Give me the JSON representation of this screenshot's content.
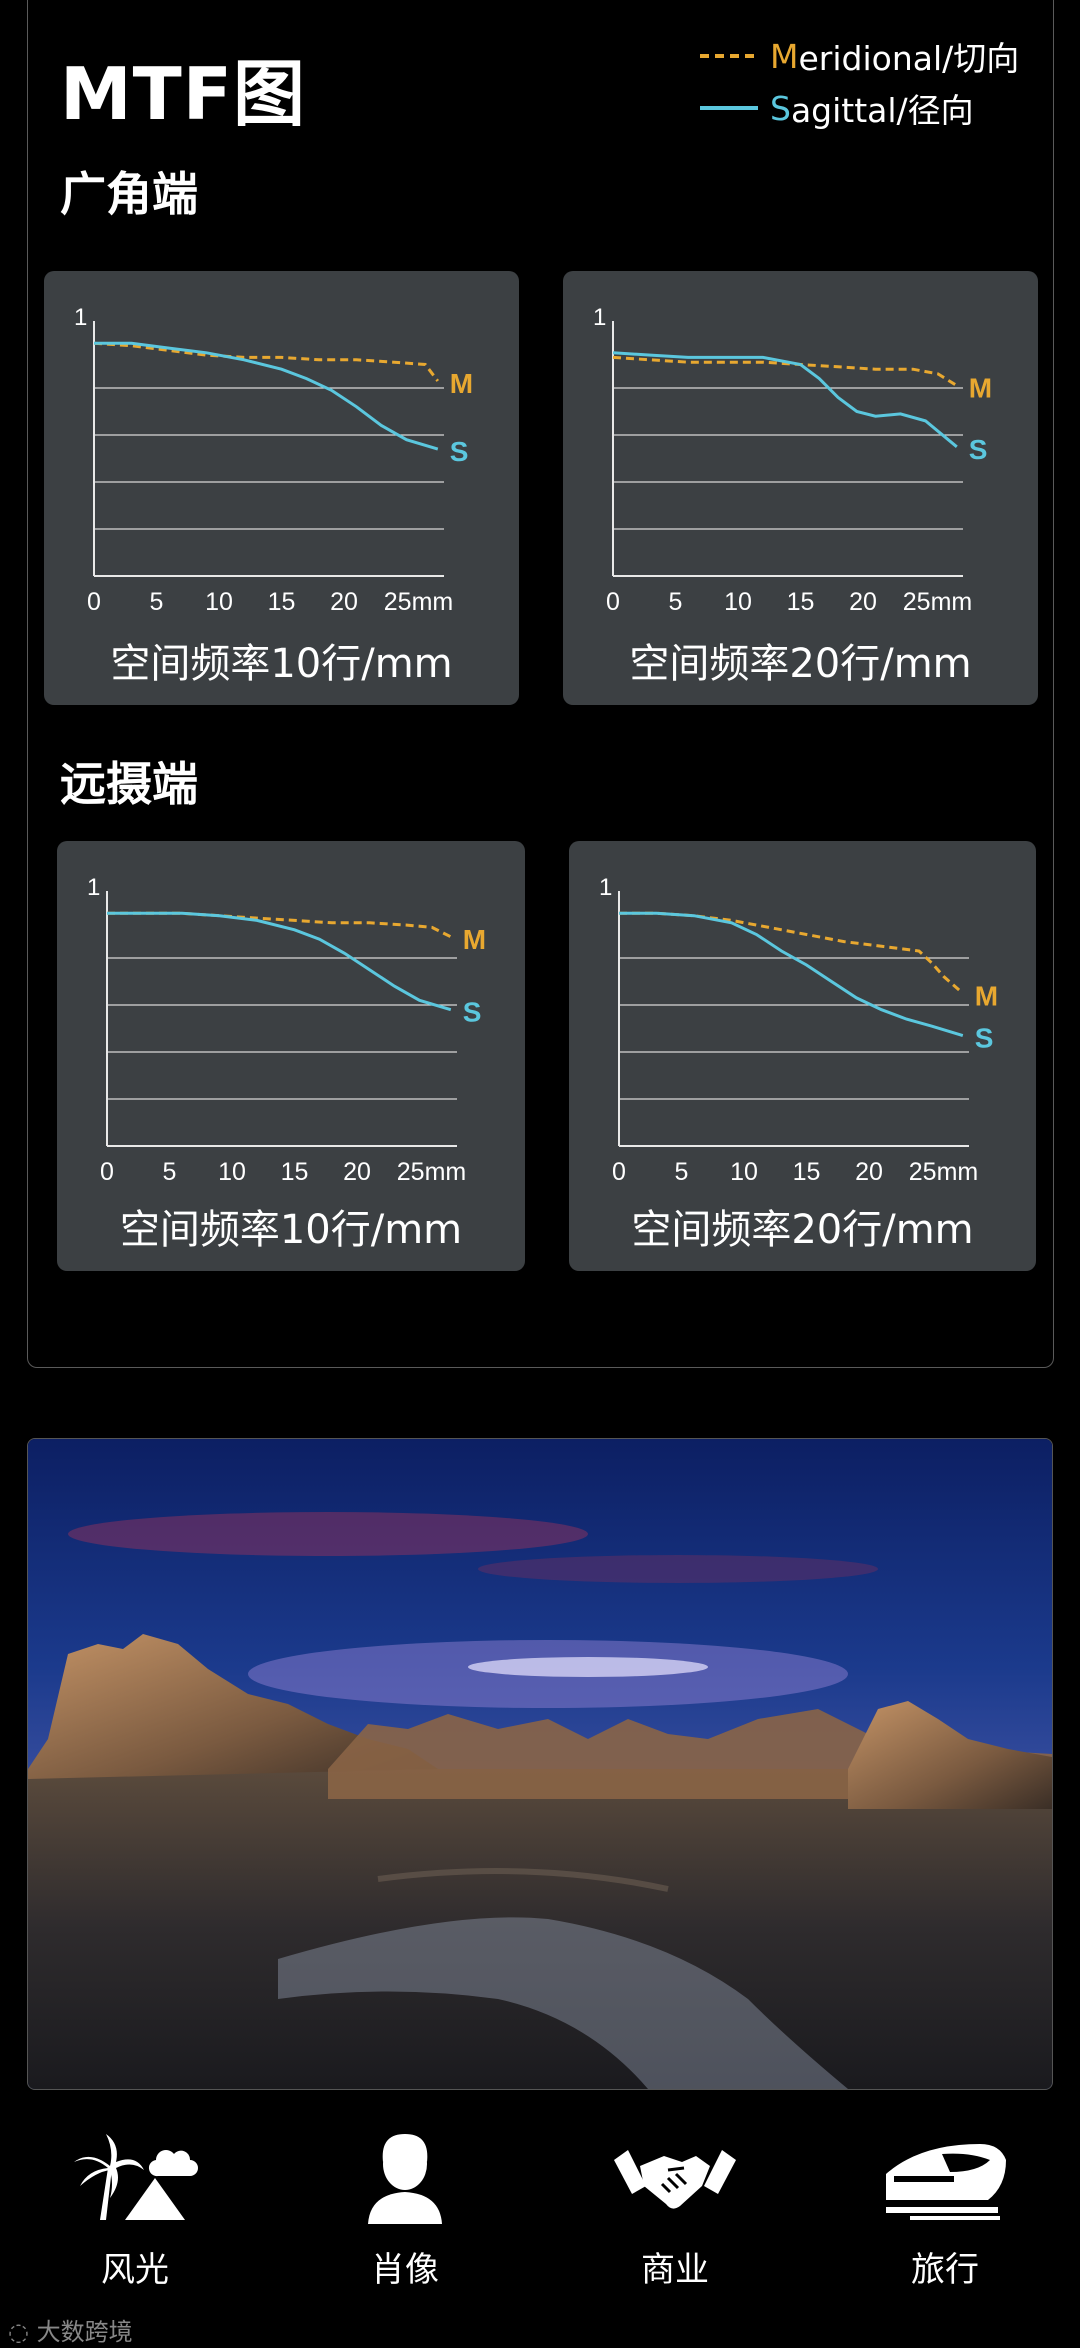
{
  "header": {
    "title": "MTF图",
    "legend": [
      {
        "initial": "M",
        "rest": "eridional/切向",
        "color": "#e8a830",
        "style": "dashed"
      },
      {
        "initial": "S",
        "rest": "agittal/径向",
        "color": "#5bc7de",
        "style": "solid"
      }
    ]
  },
  "sections": {
    "wide": "广角端",
    "tele": "远摄端"
  },
  "colors": {
    "meridional": "#e8a830",
    "sagittal": "#5bc7de",
    "panel": "#3c4043"
  },
  "chart_data": [
    {
      "type": "line",
      "section": "广角端",
      "xlabel": "空间频率10行/mm",
      "xticks": [
        "0",
        "5",
        "10",
        "15",
        "20",
        "25mm"
      ],
      "ymax_label": "1",
      "xlim": [
        0,
        28
      ],
      "ylim": [
        0,
        1
      ],
      "grid": true,
      "series": [
        {
          "name": "M",
          "x": [
            0,
            3,
            6,
            9,
            12,
            15,
            18,
            21,
            24,
            26.5,
            27.5
          ],
          "values": [
            0.99,
            0.98,
            0.96,
            0.94,
            0.93,
            0.93,
            0.92,
            0.92,
            0.91,
            0.9,
            0.83
          ]
        },
        {
          "name": "S",
          "x": [
            0,
            3,
            6,
            9,
            12,
            15,
            17,
            19,
            21,
            23,
            25,
            27.5
          ],
          "values": [
            0.99,
            0.99,
            0.97,
            0.95,
            0.92,
            0.88,
            0.84,
            0.79,
            0.72,
            0.64,
            0.58,
            0.54
          ]
        }
      ]
    },
    {
      "type": "line",
      "section": "广角端",
      "xlabel": "空间频率20行/mm",
      "xticks": [
        "0",
        "5",
        "10",
        "15",
        "20",
        "25mm"
      ],
      "ymax_label": "1",
      "xlim": [
        0,
        28
      ],
      "ylim": [
        0,
        1
      ],
      "grid": true,
      "series": [
        {
          "name": "M",
          "x": [
            0,
            3,
            6,
            9,
            12,
            15,
            18,
            21,
            24,
            26,
            27.5
          ],
          "values": [
            0.93,
            0.92,
            0.91,
            0.91,
            0.91,
            0.9,
            0.89,
            0.88,
            0.88,
            0.86,
            0.81
          ]
        },
        {
          "name": "S",
          "x": [
            0,
            3,
            6,
            9,
            12,
            15,
            16.5,
            18,
            19.5,
            21,
            23,
            25,
            27.5
          ],
          "values": [
            0.95,
            0.94,
            0.93,
            0.93,
            0.93,
            0.9,
            0.84,
            0.76,
            0.7,
            0.68,
            0.69,
            0.66,
            0.55
          ]
        }
      ]
    },
    {
      "type": "line",
      "section": "远摄端",
      "xlabel": "空间频率10行/mm",
      "xticks": [
        "0",
        "5",
        "10",
        "15",
        "20",
        "25mm"
      ],
      "ymax_label": "1",
      "xlim": [
        0,
        28
      ],
      "ylim": [
        0,
        1
      ],
      "grid": true,
      "series": [
        {
          "name": "M",
          "x": [
            0,
            3,
            6,
            9,
            12,
            15,
            18,
            21,
            24,
            26,
            27.5
          ],
          "values": [
            0.99,
            0.99,
            0.99,
            0.98,
            0.97,
            0.96,
            0.95,
            0.95,
            0.94,
            0.93,
            0.89
          ]
        },
        {
          "name": "S",
          "x": [
            0,
            3,
            6,
            9,
            12,
            15,
            17,
            19,
            21,
            23,
            25,
            27.5
          ],
          "values": [
            0.99,
            0.99,
            0.99,
            0.98,
            0.96,
            0.92,
            0.88,
            0.82,
            0.75,
            0.68,
            0.62,
            0.58
          ]
        }
      ]
    },
    {
      "type": "line",
      "section": "远摄端",
      "xlabel": "空间频率20行/mm",
      "xticks": [
        "0",
        "5",
        "10",
        "15",
        "20",
        "25mm"
      ],
      "ymax_label": "1",
      "xlim": [
        0,
        28
      ],
      "ylim": [
        0,
        1
      ],
      "grid": true,
      "series": [
        {
          "name": "M",
          "x": [
            0,
            3,
            6,
            9,
            12,
            15,
            18,
            21,
            24,
            25,
            26,
            27.5
          ],
          "values": [
            0.99,
            0.99,
            0.98,
            0.96,
            0.93,
            0.9,
            0.87,
            0.85,
            0.83,
            0.78,
            0.72,
            0.65
          ]
        },
        {
          "name": "S",
          "x": [
            0,
            3,
            6,
            9,
            11,
            13,
            15,
            17,
            19,
            21,
            23,
            25,
            27.5
          ],
          "values": [
            0.99,
            0.99,
            0.98,
            0.95,
            0.9,
            0.83,
            0.77,
            0.7,
            0.63,
            0.58,
            0.54,
            0.51,
            0.47
          ]
        }
      ]
    }
  ],
  "bottom_nav": [
    {
      "label": "风光",
      "icon": "landscape-icon"
    },
    {
      "label": "肖像",
      "icon": "portrait-icon"
    },
    {
      "label": "商业",
      "icon": "handshake-icon"
    },
    {
      "label": "旅行",
      "icon": "train-icon"
    }
  ],
  "watermark": "大数跨境"
}
